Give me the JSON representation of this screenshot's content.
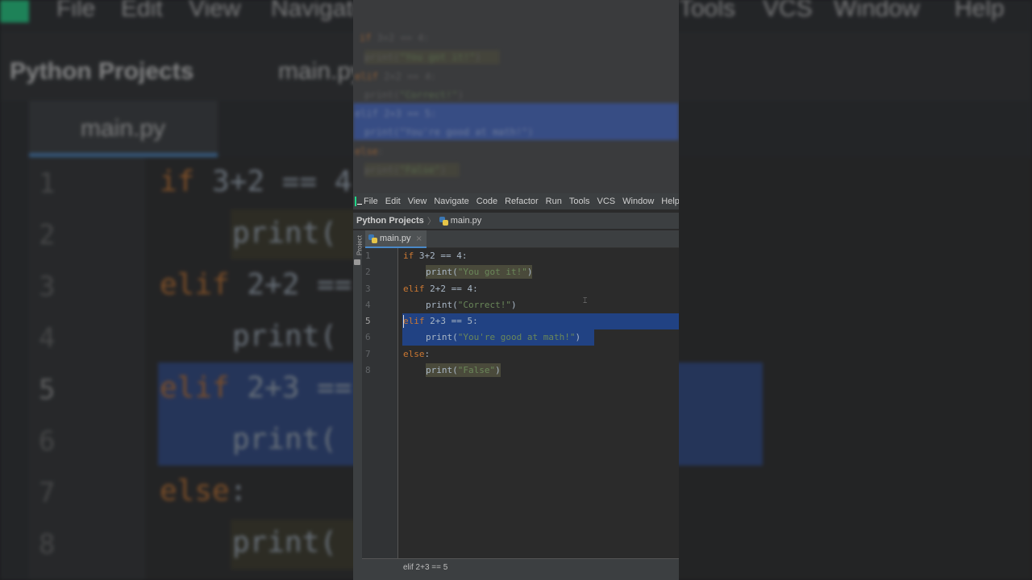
{
  "app": {
    "icon_name": "pycharm-app-icon",
    "accent": "#21d789"
  },
  "menu": [
    "File",
    "Edit",
    "View",
    "Navigate",
    "Code",
    "Refactor",
    "Run",
    "Tools",
    "VCS",
    "Window",
    "Help"
  ],
  "breadcrumb": {
    "project": "Python Projects",
    "separator": "〉",
    "file": "main.py"
  },
  "sidebar": {
    "label": "Project"
  },
  "tab": {
    "label": "main.py",
    "close": "×"
  },
  "lines": [
    "1",
    "2",
    "3",
    "4",
    "5",
    "6",
    "7",
    "8"
  ],
  "code": {
    "l1_kw": "if",
    "l1_rest": " 3+2 == 4:",
    "l2_fn": "print(",
    "l2_str": "\"You got it!\"",
    "l2_end": ")",
    "l3_kw": "elif",
    "l3_rest": " 2+2 == 4:",
    "l4_fn": "print(",
    "l4_str": "\"Correct!\"",
    "l4_end": ")",
    "l5_kw": "elif",
    "l5_rest": " 2+3 == 5:",
    "l6_fn": "print(",
    "l6_str": "\"You're good at math!\"",
    "l6_end": ")",
    "l7_kw": "else",
    "l7_rest": ":",
    "l8_fn": "print(",
    "l8_str": "\"False\"",
    "l8_end": ")"
  },
  "status": {
    "text": "elif 2+3 == 5"
  },
  "colors": {
    "keyword": "#cc7832",
    "string": "#6a8759",
    "selection": "#214283",
    "editor_bg": "#2b2b2b"
  }
}
